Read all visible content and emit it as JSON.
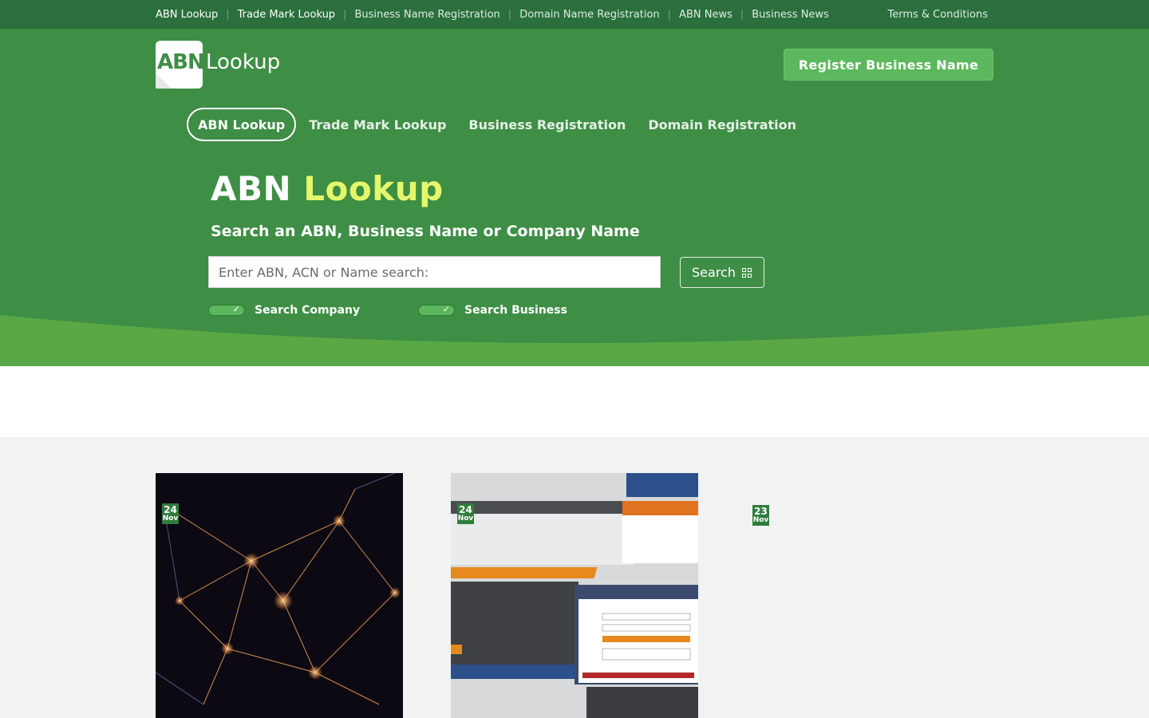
{
  "topbar": {
    "links": [
      "ABN Lookup",
      "Trade Mark Lookup",
      "Business Name Registration",
      "Domain Name Registration",
      "ABN News",
      "Business News"
    ],
    "terms": "Terms & Conditions"
  },
  "logo": {
    "part1": "ABN",
    "part2": "Lookup"
  },
  "register_button": "Register Business Name",
  "main_nav": [
    "ABN Lookup",
    "Trade Mark Lookup",
    "Business Registration",
    "Domain Registration"
  ],
  "hero": {
    "title_1": "ABN",
    "title_2": "Lookup",
    "subtitle": "Search an ABN, Business Name or Company Name",
    "search_placeholder": "Enter ABN, ACN or Name search:",
    "search_button": "Search",
    "toggle_company": "Search Company",
    "toggle_business": "Search Business"
  },
  "news": [
    {
      "day": "24",
      "month": "Nov"
    },
    {
      "day": "24",
      "month": "Nov"
    },
    {
      "day": "23",
      "month": "Nov"
    }
  ],
  "colors": {
    "topbar": "#2a6f3c",
    "hero": "#3e8e45",
    "accent": "#e4f76b",
    "button": "#5cb85c"
  }
}
